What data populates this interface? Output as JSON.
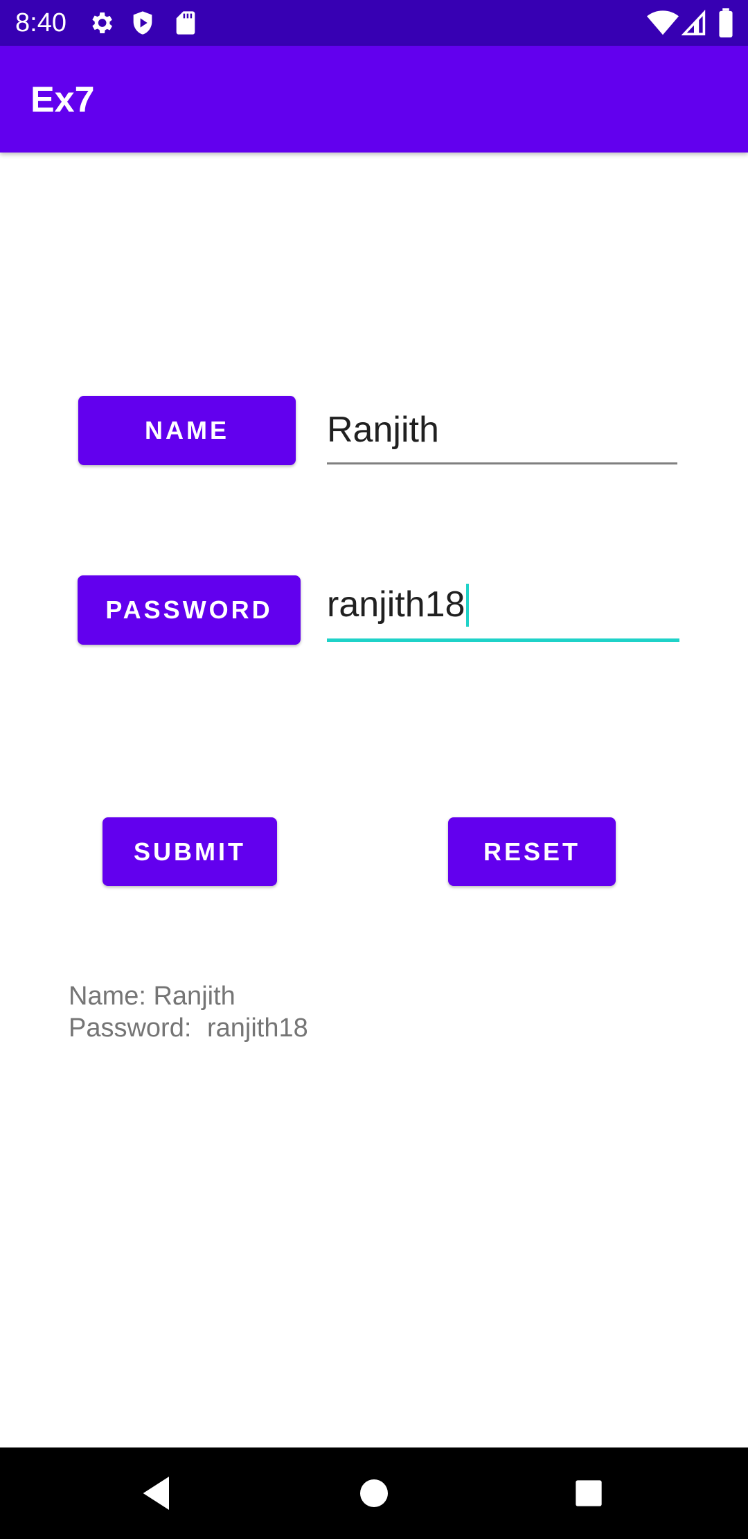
{
  "status_bar": {
    "time": "8:40",
    "icons_left": [
      "gear-icon",
      "shield-play-icon",
      "sd-card-icon"
    ],
    "icons_right": [
      "wifi-icon",
      "signal-icon",
      "battery-icon"
    ]
  },
  "app_bar": {
    "title": "Ex7"
  },
  "form": {
    "name_button_label": "NAME",
    "name_value": "Ranjith",
    "password_button_label": "PASSWORD",
    "password_value": "ranjith18"
  },
  "actions": {
    "submit_label": "SUBMIT",
    "reset_label": "RESET"
  },
  "output": {
    "name_label": "Name:",
    "name_value": "Ranjith",
    "password_label": "Password:",
    "password_value": "ranjith18"
  },
  "nav_bar": {
    "buttons": [
      "back-icon",
      "home-icon",
      "recents-icon"
    ]
  },
  "colors": {
    "status_bar": "#3700b3",
    "primary": "#6200ee",
    "accent": "#1fd2c8",
    "nav_bar": "#000000"
  }
}
